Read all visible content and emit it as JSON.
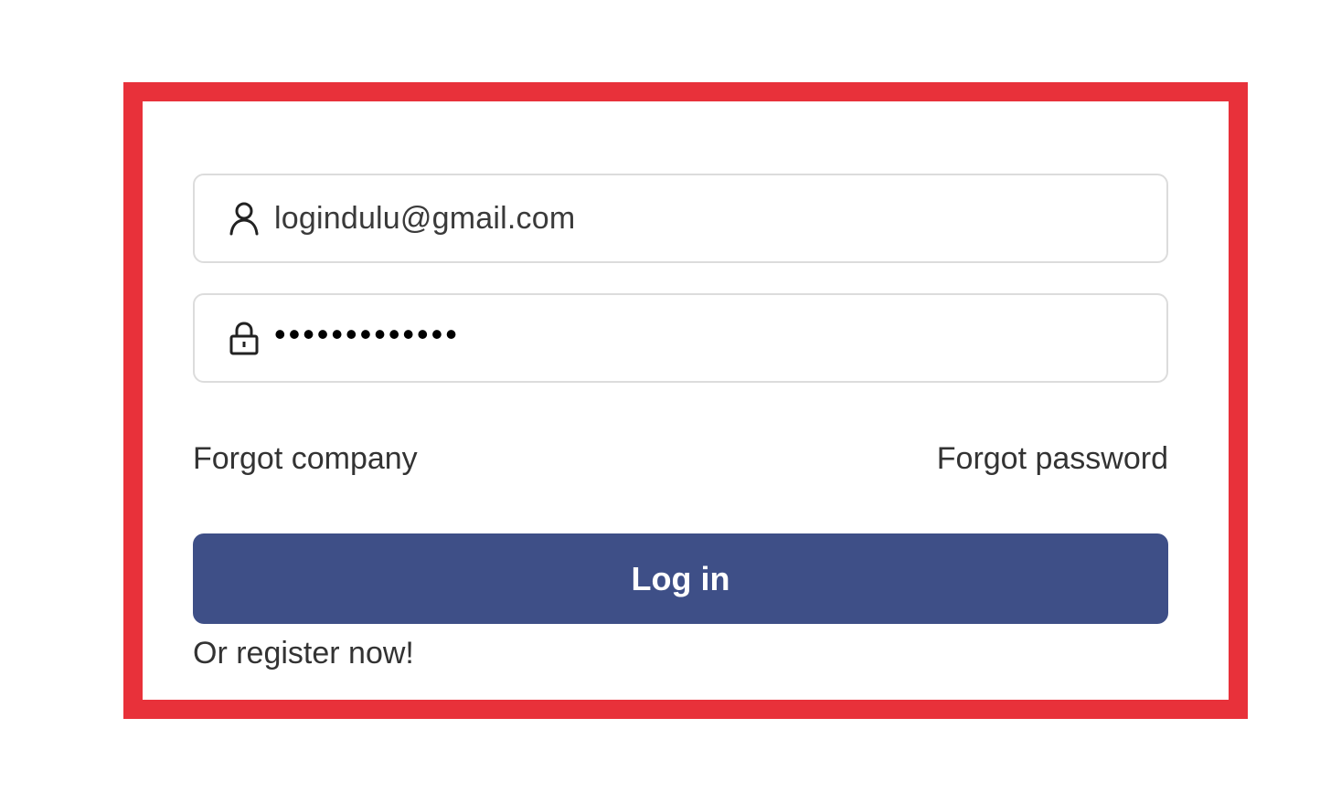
{
  "login_form": {
    "username": {
      "icon": "user-icon",
      "value": "logindulu@gmail.com"
    },
    "password": {
      "icon": "lock-icon",
      "masked_value": "•••••••••••••"
    },
    "forgot_company_label": "Forgot company",
    "forgot_password_label": "Forgot password",
    "login_button_label": "Log in",
    "register_label": "Or register now!"
  },
  "colors": {
    "highlight_frame": "#e8313a",
    "button_background": "#3e4f87",
    "button_text": "#ffffff"
  }
}
